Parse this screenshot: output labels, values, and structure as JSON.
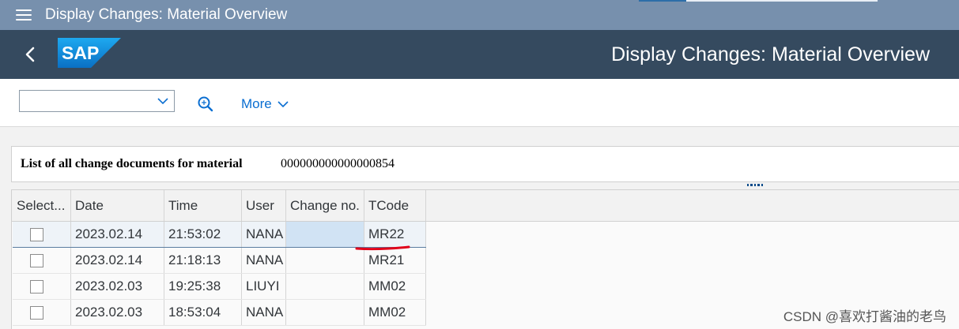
{
  "window": {
    "title": "Display Changes: Material Overview"
  },
  "shell": {
    "logo_text": "SAP",
    "title": "Display Changes: Material Overview"
  },
  "toolbar": {
    "dropdown_value": "",
    "search_icon": "search-icon",
    "more_label": "More"
  },
  "header": {
    "label": "List of all change documents for material",
    "material_number": "000000000000000854"
  },
  "table": {
    "columns": [
      "Select...",
      "Date",
      "Time",
      "User",
      "Change no.",
      "TCode"
    ],
    "rows": [
      {
        "checked": false,
        "date": "2023.02.14",
        "time": "21:53:02",
        "user": "NANA",
        "change_no": "",
        "tcode": "MR22"
      },
      {
        "checked": false,
        "date": "2023.02.14",
        "time": "21:18:13",
        "user": "NANA",
        "change_no": "",
        "tcode": "MR21"
      },
      {
        "checked": false,
        "date": "2023.02.03",
        "time": "19:25:38",
        "user": "LIUYI",
        "change_no": "",
        "tcode": "MM02"
      },
      {
        "checked": false,
        "date": "2023.02.03",
        "time": "18:53:04",
        "user": "NANA",
        "change_no": "",
        "tcode": "MM02"
      }
    ]
  },
  "watermark": "CSDN @喜欢打酱油的老鸟",
  "colors": {
    "topbar": "#7790ad",
    "shell": "#354a5f",
    "accent": "#0a6ed1",
    "annotation": "#e0001a"
  }
}
